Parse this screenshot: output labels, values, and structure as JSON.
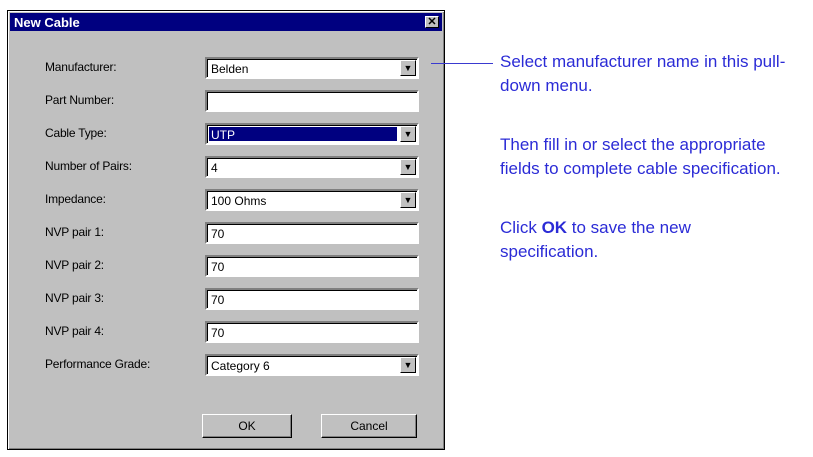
{
  "dialog": {
    "title": "New Cable",
    "close_symbol": "✕",
    "fields": [
      {
        "label": "Manufacturer:",
        "value": "Belden",
        "type": "dropdown"
      },
      {
        "label": "Part Number:",
        "value": "",
        "type": "text"
      },
      {
        "label": "Cable Type:",
        "value": "UTP",
        "type": "dropdown",
        "selected": true
      },
      {
        "label": "Number of Pairs:",
        "value": "4",
        "type": "dropdown"
      },
      {
        "label": "Impedance:",
        "value": "100 Ohms",
        "type": "dropdown"
      },
      {
        "label": "NVP pair 1:",
        "value": "70",
        "type": "text"
      },
      {
        "label": "NVP pair 2:",
        "value": "70",
        "type": "text"
      },
      {
        "label": "NVP pair 3:",
        "value": "70",
        "type": "text"
      },
      {
        "label": "NVP pair 4:",
        "value": "70",
        "type": "text"
      },
      {
        "label": "Performance Grade:",
        "value": "Category 6",
        "type": "dropdown"
      }
    ],
    "ok_label": "OK",
    "cancel_label": "Cancel"
  },
  "annotations": {
    "line1": "Select manufacturer name in this pull-",
    "line2": "down menu.",
    "line3": "Then fill in or select the appropriate",
    "line4": "fields to complete cable specification.",
    "line5_pre": "Click ",
    "line5_bold": "OK",
    "line5_post": " to save the new",
    "line6": "specification."
  },
  "colors": {
    "titlebar": "#000080",
    "annotation_text": "#2b2bd6",
    "dialog_bg": "#c0c0c0"
  },
  "icons": {
    "dropdown": "triangle-down-icon",
    "close": "close-icon"
  }
}
